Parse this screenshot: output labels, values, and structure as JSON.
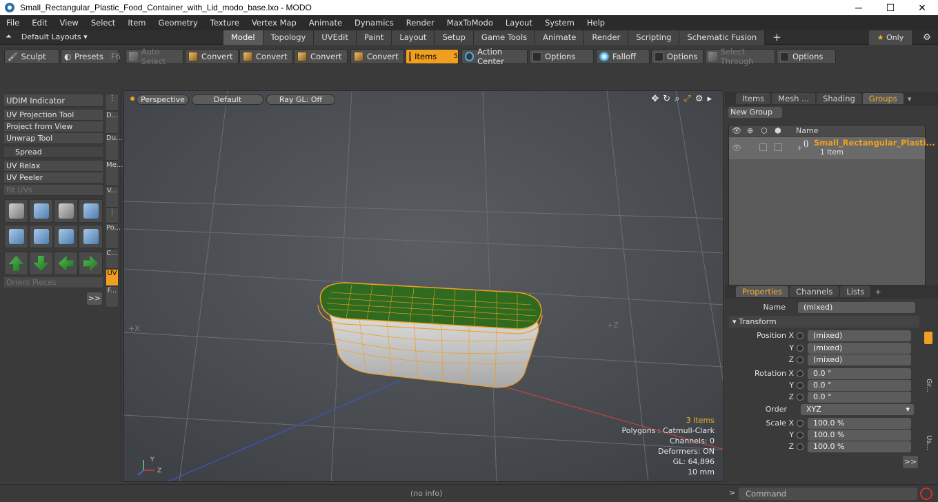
{
  "window": {
    "title": "Small_Rectangular_Plastic_Food_Container_with_Lid_modo_base.lxo - MODO",
    "min": "─",
    "max": "☐",
    "close": "✕"
  },
  "menu": [
    "File",
    "Edit",
    "View",
    "Select",
    "Item",
    "Geometry",
    "Texture",
    "Vertex Map",
    "Animate",
    "Dynamics",
    "Render",
    "MaxToModo",
    "Layout",
    "System",
    "Help"
  ],
  "layouts": {
    "label": "Default Layouts ▾"
  },
  "tabs": [
    "Model",
    "Topology",
    "UVEdit",
    "Paint",
    "Layout",
    "Setup",
    "Game Tools",
    "Animate",
    "Render",
    "Scripting",
    "Schematic Fusion",
    "+"
  ],
  "only": {
    "star": "★",
    "label": "Only"
  },
  "toolbar": {
    "sculpt": "Sculpt",
    "presets": "Presets",
    "presets_key": "F6",
    "auto_select": "Auto Select",
    "convert": "Convert",
    "items": "Items",
    "items_key": "5",
    "action_center": "Action Center",
    "options": "Options",
    "falloff": "Falloff",
    "select_through": "Select Through"
  },
  "left": {
    "udim": "UDIM Indicator",
    "uv_projection": "UV Projection Tool",
    "project_view": "Project from View",
    "unwrap": "Unwrap Tool",
    "spread": "Spread",
    "uv_relax": "UV Relax",
    "uv_peeler": "UV Peeler",
    "fit_uvs": "Fit UVs",
    "orient": "Orient Pieces",
    "more": ">>",
    "vtabs": [
      "D...",
      "Du...",
      "Me...",
      "V...",
      "Po...",
      "C...",
      "UV",
      "F..."
    ]
  },
  "viewport": {
    "perspective": "Perspective",
    "default": "Default",
    "raygl": "Ray GL: Off",
    "axis_x": "+X",
    "axis_z": "+Z",
    "stats": {
      "items": "3 Items",
      "polygons": "Polygons : Catmull-Clark",
      "channels": "Channels: 0",
      "deformers": "Deformers: ON",
      "gl": "GL: 64,896",
      "unit": "10 mm"
    }
  },
  "groups": {
    "tabs": [
      "Items",
      "Mesh ...",
      "Shading",
      "Groups"
    ],
    "new_group": "New Group",
    "col_name": "Name",
    "item_name": "Small_Rectangular_Plasti...",
    "item_count": "1 Item"
  },
  "properties": {
    "tabs": [
      "Properties",
      "Channels",
      "Lists",
      "+"
    ],
    "name_label": "Name",
    "name_value": "(mixed)",
    "transform": "Transform",
    "position": [
      {
        "label": "Position X",
        "value": "(mixed)"
      },
      {
        "label": "Y",
        "value": "(mixed)"
      },
      {
        "label": "Z",
        "value": "(mixed)"
      }
    ],
    "rotation": [
      {
        "label": "Rotation X",
        "value": "0.0 °"
      },
      {
        "label": "Y",
        "value": "0.0 °"
      },
      {
        "label": "Z",
        "value": "0.0 °"
      }
    ],
    "order_label": "Order",
    "order_value": "XYZ",
    "scale": [
      {
        "label": "Scale X",
        "value": "100.0 %"
      },
      {
        "label": "Y",
        "value": "100.0 %"
      },
      {
        "label": "Z",
        "value": "100.0 %"
      }
    ],
    "side_tabs": [
      "Gr...",
      "Us..."
    ],
    "more": ">>"
  },
  "status": {
    "info": "(no info)",
    "prompt": ">",
    "command": "Command"
  },
  "colors": {
    "accent": "#f0a020",
    "viewport_bg": "#4a4e52",
    "mesh_wire": "#f0a020",
    "lid_fill": "#2f6b1f"
  }
}
